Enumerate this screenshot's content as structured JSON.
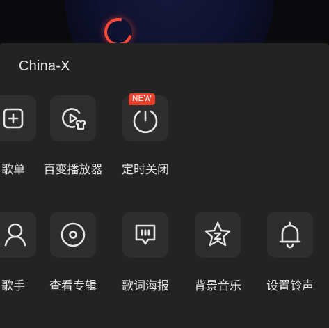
{
  "sheet": {
    "title": "China-X"
  },
  "row1": [
    {
      "label": "歌单",
      "icon": "add-playlist-icon"
    },
    {
      "label": "百变播放器",
      "icon": "player-skin-icon"
    },
    {
      "label": "定时关闭",
      "icon": "timer-icon",
      "badge": "NEW"
    }
  ],
  "row2": [
    {
      "label": "歌手",
      "icon": "singer-icon"
    },
    {
      "label": "查看专辑",
      "icon": "album-icon"
    },
    {
      "label": "歌词海报",
      "icon": "lyrics-poster-icon"
    },
    {
      "label": "背景音乐",
      "icon": "background-music-icon"
    },
    {
      "label": "设置铃声",
      "icon": "ringtone-bell-icon"
    }
  ],
  "colors": {
    "sheet_bg": "#232323",
    "tile_bg": "#2e2e2e",
    "badge_bg": "#e8402c",
    "text": "#e6e6e6"
  }
}
